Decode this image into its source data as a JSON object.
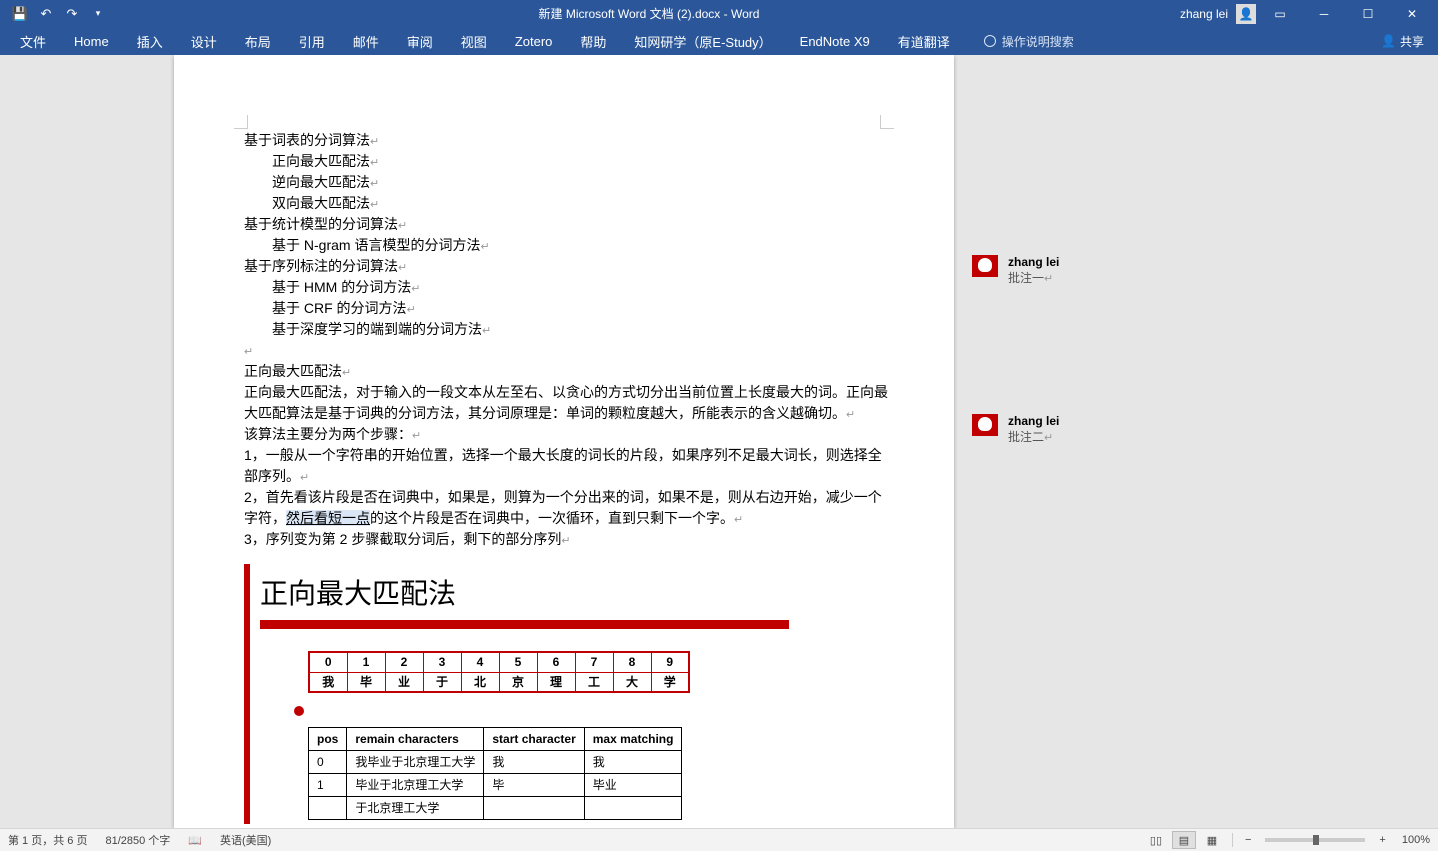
{
  "title": "新建 Microsoft Word 文档 (2).docx  -  Word",
  "user": {
    "name": "zhang lei"
  },
  "ribbon": {
    "file": "文件",
    "tabs": [
      "Home",
      "插入",
      "设计",
      "布局",
      "引用",
      "邮件",
      "审阅",
      "视图",
      "Zotero",
      "帮助",
      "知网研学（原E-Study）",
      "EndNote X9",
      "有道翻译"
    ],
    "tell_me": "操作说明搜索",
    "share": "共享"
  },
  "doc": {
    "lines": [
      {
        "t": "基于词表的分词算法",
        "i": 0
      },
      {
        "t": "正向最大匹配法",
        "i": 1
      },
      {
        "t": "逆向最大匹配法",
        "i": 1
      },
      {
        "t": "双向最大匹配法",
        "i": 1
      },
      {
        "t": "基于统计模型的分词算法",
        "i": 0
      },
      {
        "t": "基于 N-gram 语言模型的分词方法",
        "i": 1
      },
      {
        "t": "基于序列标注的分词算法",
        "i": 0
      },
      {
        "t": "基于 HMM 的分词方法",
        "i": 1
      },
      {
        "t": "基于 CRF 的分词方法",
        "i": 1
      },
      {
        "t": "基于深度学习的端到端的分词方法",
        "i": 1
      }
    ],
    "blank": "",
    "h": "正向最大匹配法",
    "p1": "正向最大匹配法，对于输入的一段文本从左至右、以贪心的方式切分出当前位置上长度最大的词。正向最大匹配算法是基于词典的分词方法，其分词原理是：单词的颗粒度越大，所能表示的含义越确切。",
    "p2": "该算法主要分为两个步骤：",
    "p3": "1，一般从一个字符串的开始位置，选择一个最大长度的词长的片段，如果序列不足最大词长，则选择全部序列。",
    "p4a": "2，首先看该片段是否在词典中，如果是，则算为一个分出来的词，如果不是，则从右边开始，减少一个字符，",
    "p4sel": "然后看短一点",
    "p4b": "的这个片段是否在词典中，一次循环，直到只剩下一个字。",
    "p5": "3，序列变为第 2 步骤截取分词后，剩下的部分序列"
  },
  "embed": {
    "title": "正向最大匹配法",
    "indices": [
      "0",
      "1",
      "2",
      "3",
      "4",
      "5",
      "6",
      "7",
      "8",
      "9"
    ],
    "chars": [
      "我",
      "毕",
      "业",
      "于",
      "北",
      "京",
      "理",
      "工",
      "大",
      "学"
    ],
    "headers": [
      "pos",
      "remain characters",
      "start character",
      "max matching"
    ],
    "rows": [
      [
        "0",
        "我毕业于北京理工大学",
        "我",
        "我"
      ],
      [
        "1",
        "毕业于北京理工大学",
        "毕",
        "毕业"
      ]
    ],
    "partial": "于北京理工大学"
  },
  "comments": [
    {
      "author": "zhang lei",
      "text": "批注一"
    },
    {
      "author": "zhang lei",
      "text": "批注二"
    }
  ],
  "status": {
    "page": "第 1 页，共 6 页",
    "words": "81/2850 个字",
    "lang": "英语(美国)",
    "zoom_minus": "−",
    "zoom_plus": "+",
    "zoom": "100%"
  }
}
